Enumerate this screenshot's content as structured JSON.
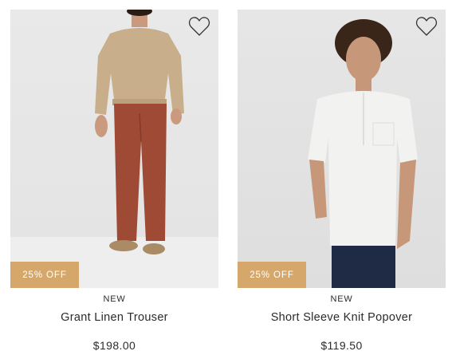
{
  "products": [
    {
      "badge": "25% OFF",
      "tag": "NEW",
      "name": "Grant Linen Trouser",
      "price": "$198.00",
      "wishlist_icon": "heart-outline-icon"
    },
    {
      "badge": "25% OFF",
      "tag": "NEW",
      "name": "Short Sleeve Knit Popover",
      "price": "$119.50",
      "wishlist_icon": "heart-outline-icon"
    }
  ],
  "colors": {
    "badge_bg": "#d5a76b",
    "badge_text": "#ffffff",
    "text": "#2b2b2b",
    "photo_bg": "#e7e7e7"
  }
}
